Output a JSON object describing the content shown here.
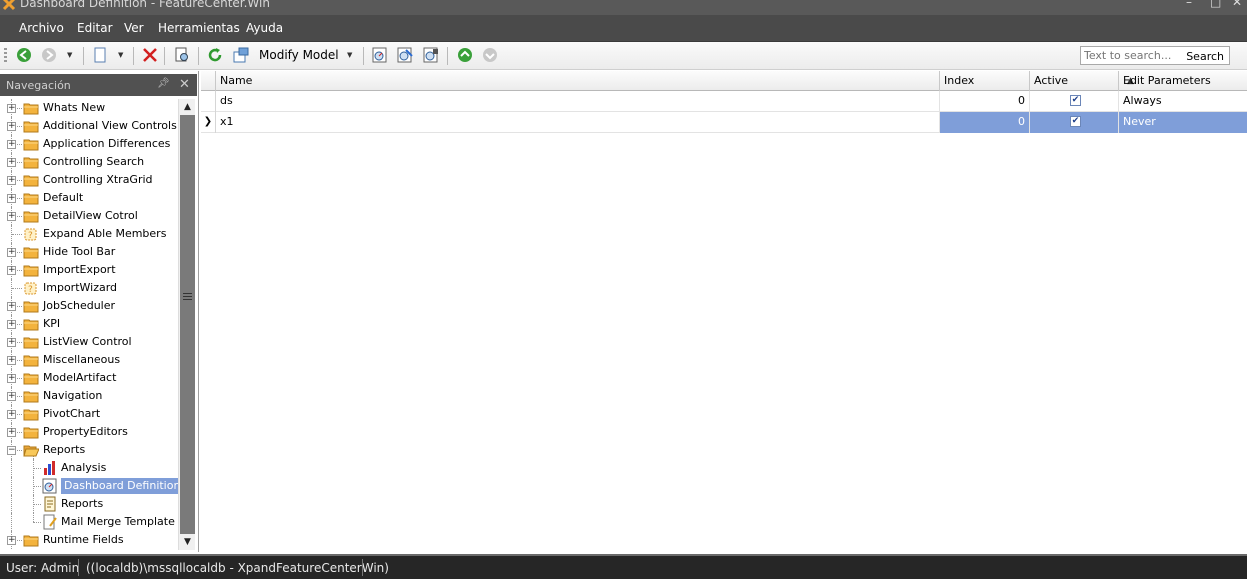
{
  "window": {
    "title": "Dashboard Definition - FeatureCenter.Win"
  },
  "menu": [
    "Archivo",
    "Editar",
    "Ver",
    "Herramientas",
    "Ayuda"
  ],
  "toolbar": {
    "modify_model_label": "Modify Model",
    "search_placeholder": "Text to search...",
    "search_button": "Search"
  },
  "navigation": {
    "header": "Navegación",
    "items": [
      {
        "label": "Whats New",
        "icon": "folder-icon"
      },
      {
        "label": "Additional View Controls",
        "icon": "folder-icon"
      },
      {
        "label": "Application Differences",
        "icon": "folder-icon"
      },
      {
        "label": "Controlling Search",
        "icon": "folder-icon"
      },
      {
        "label": "Controlling XtraGrid",
        "icon": "folder-icon"
      },
      {
        "label": "Default",
        "icon": "folder-icon"
      },
      {
        "label": "DetailView Cotrol",
        "icon": "folder-icon"
      },
      {
        "label": "Expand Able Members",
        "icon": "puzzle-icon"
      },
      {
        "label": "Hide Tool Bar",
        "icon": "folder-icon"
      },
      {
        "label": "ImportExport",
        "icon": "folder-icon"
      },
      {
        "label": "ImportWizard",
        "icon": "puzzle-icon"
      },
      {
        "label": "JobScheduler",
        "icon": "folder-icon"
      },
      {
        "label": "KPI",
        "icon": "folder-icon"
      },
      {
        "label": "ListView Control",
        "icon": "folder-icon"
      },
      {
        "label": "Miscellaneous",
        "icon": "folder-icon"
      },
      {
        "label": "ModelArtifact",
        "icon": "folder-icon"
      },
      {
        "label": "Navigation",
        "icon": "folder-icon"
      },
      {
        "label": "PivotChart",
        "icon": "folder-icon"
      },
      {
        "label": "PropertyEditors",
        "icon": "folder-icon"
      },
      {
        "label": "Reports",
        "icon": "folder-open-icon",
        "expanded": true
      },
      {
        "label": "Analysis",
        "icon": "bar-chart-icon",
        "child": true
      },
      {
        "label": "Dashboard Definition",
        "icon": "dashboard-icon",
        "child": true,
        "selected": true
      },
      {
        "label": "Reports",
        "icon": "report-icon",
        "child": true
      },
      {
        "label": "Mail Merge Template",
        "icon": "document-pen-icon",
        "child": true
      },
      {
        "label": "Runtime Fields",
        "icon": "folder-icon"
      }
    ]
  },
  "grid": {
    "columns": [
      "Name",
      "Index",
      "Active",
      "Edit Parameters"
    ],
    "rows": [
      {
        "name": "ds",
        "index": "0",
        "active": true,
        "edit_parameters": "Always"
      },
      {
        "name": "x1",
        "index": "0",
        "active": true,
        "edit_parameters": "Never",
        "focused": true
      }
    ]
  },
  "status": {
    "user": "User: Admin",
    "connection": "((localdb)\\mssqllocaldb - XpandFeatureCenterWin)"
  },
  "colors": {
    "selection": "#7f9ed9",
    "menubar": "#4a4a4a",
    "statusbar": "#262626"
  }
}
